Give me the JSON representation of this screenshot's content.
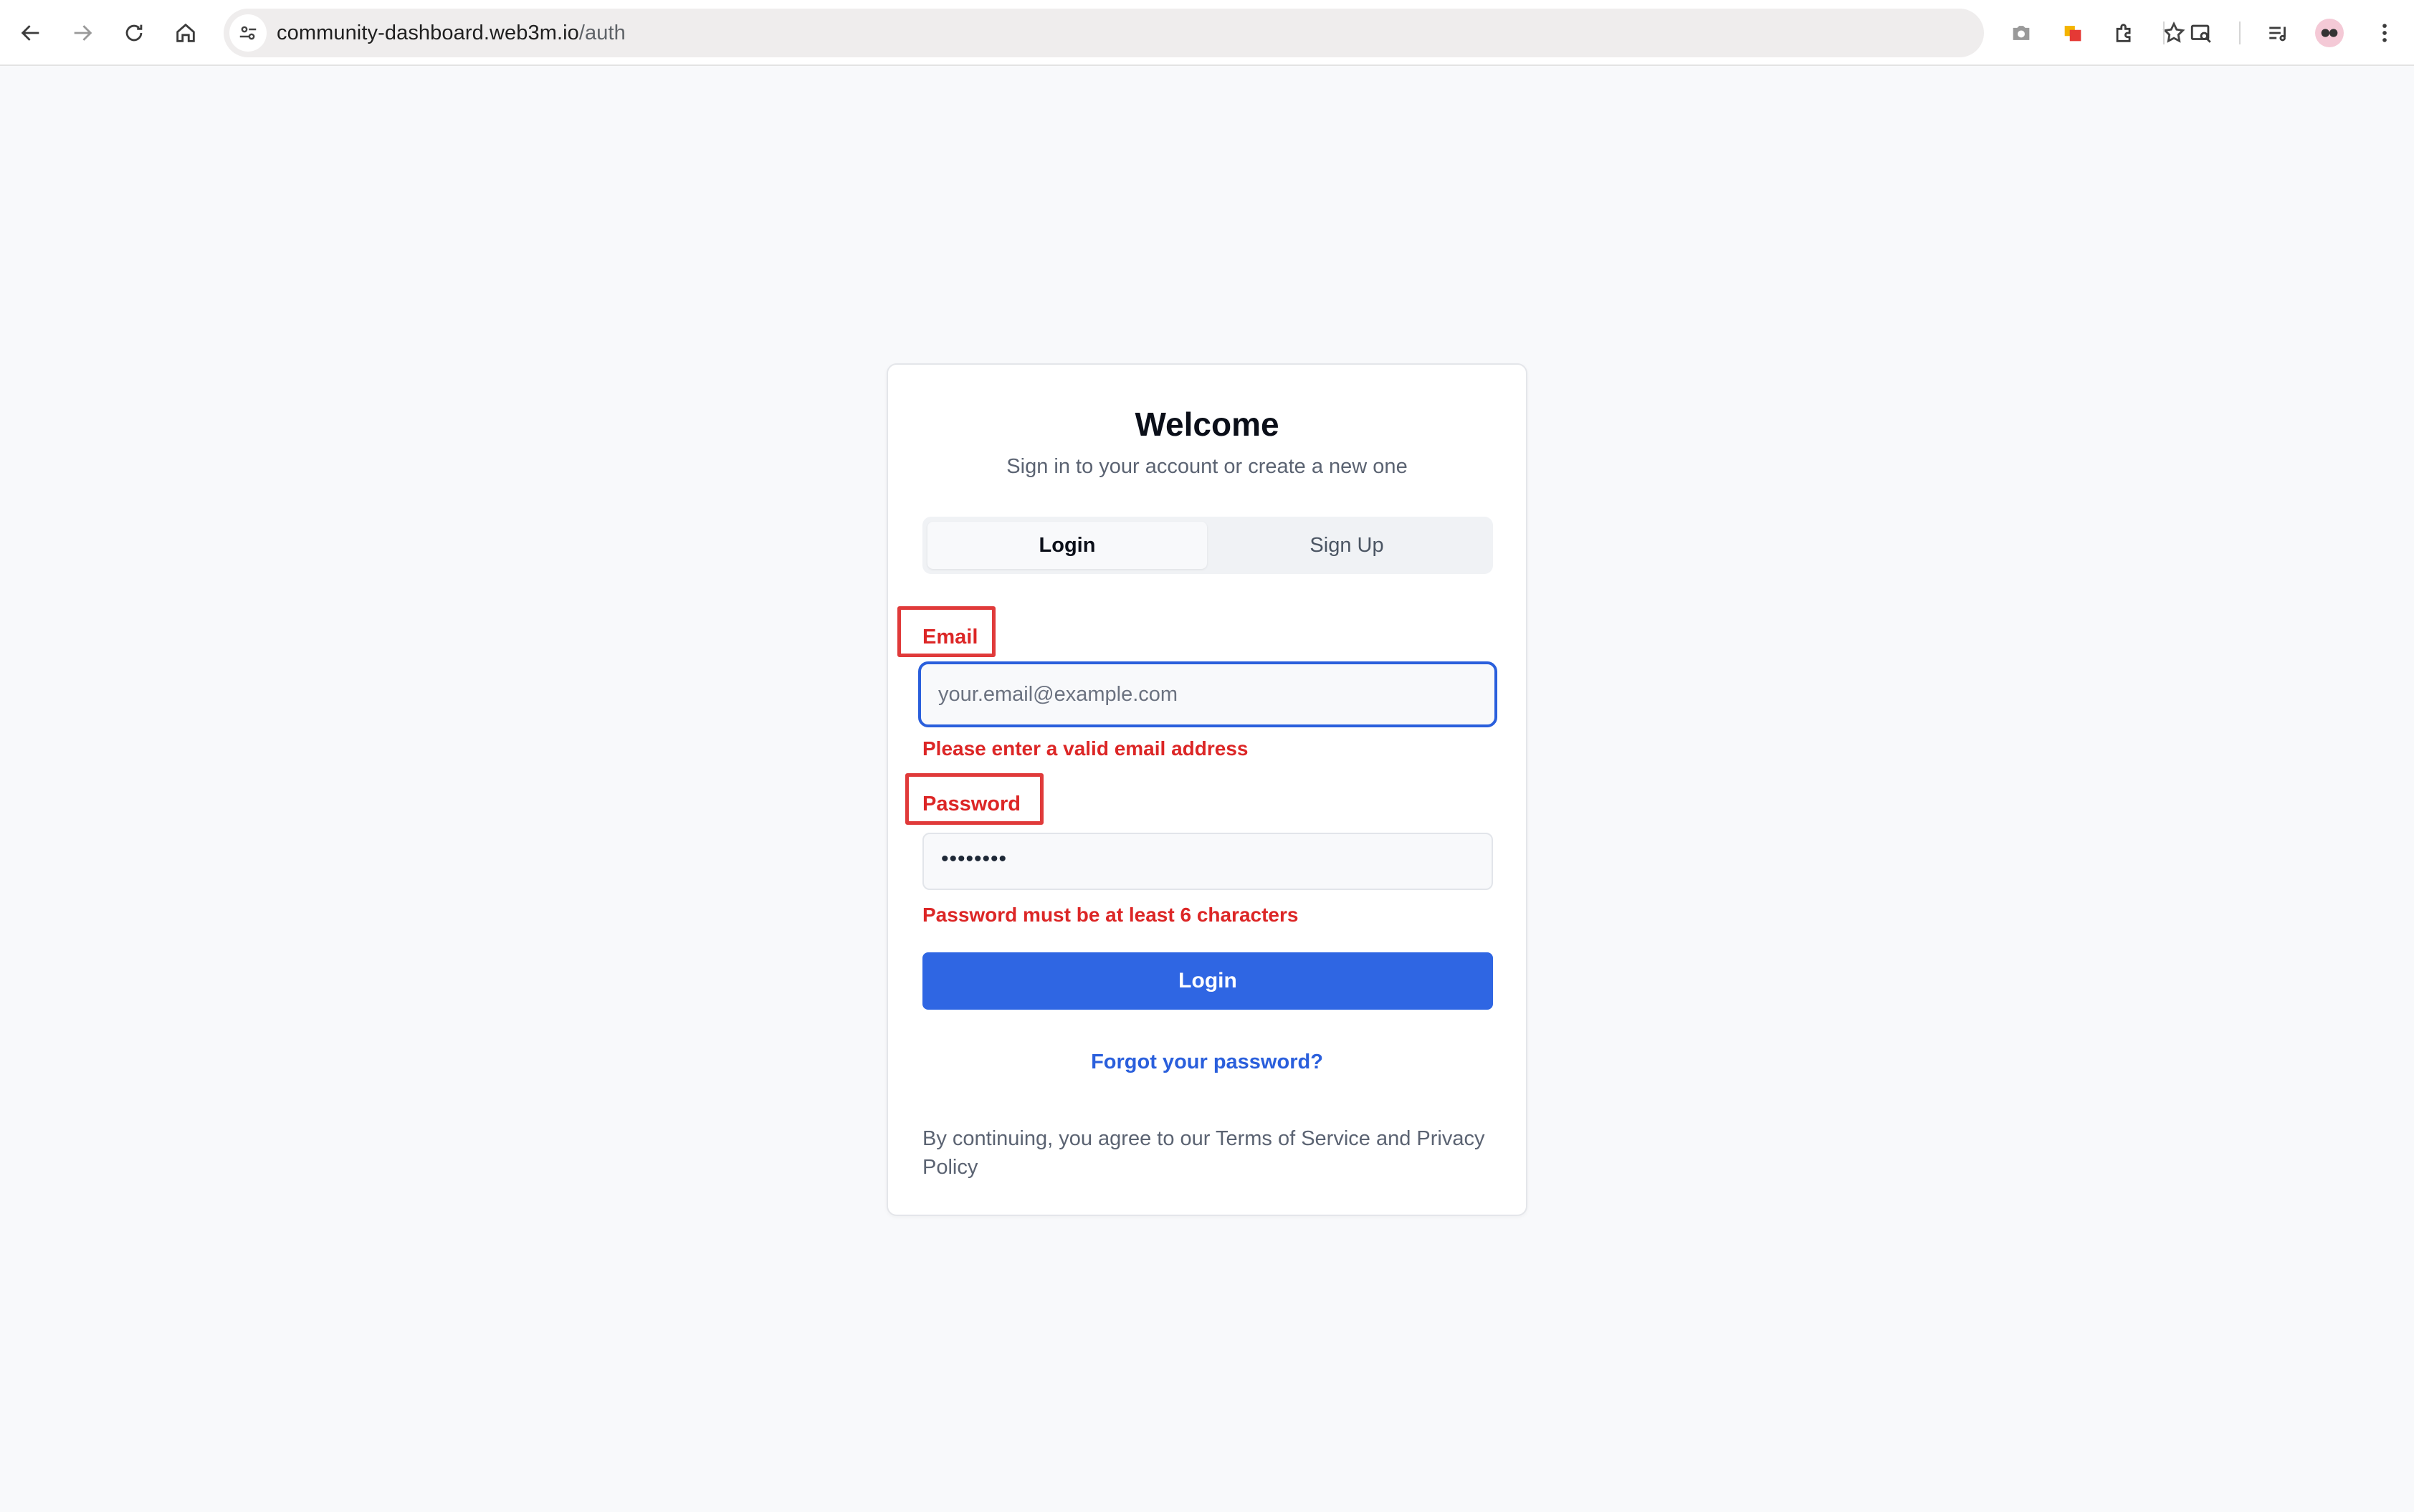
{
  "browser": {
    "url_host": "community-dashboard.web3m.io",
    "url_path": "/auth",
    "icons": [
      "back-icon",
      "forward-icon",
      "reload-icon",
      "home-icon",
      "site-info-icon",
      "bookmark-star-icon",
      "camera-icon",
      "extension-office-icon",
      "puzzle-icon",
      "search-tab-icon",
      "media-icon",
      "profile-avatar",
      "menu-icon"
    ]
  },
  "auth": {
    "title": "Welcome",
    "subtitle": "Sign in to your account or create a new one",
    "tabs": [
      {
        "label": "Login",
        "active": true
      },
      {
        "label": "Sign Up",
        "active": false
      }
    ],
    "email": {
      "label": "Email",
      "placeholder": "your.email@example.com",
      "value": "",
      "error": "Please enter a valid email address"
    },
    "password": {
      "label": "Password",
      "masked_value": "••••••••",
      "error": "Password must be at least 6 characters"
    },
    "submit_label": "Login",
    "forgot_label": "Forgot your password?",
    "terms_text": "By continuing, you agree to our Terms of Service and Privacy Policy"
  },
  "colors": {
    "accent": "#2f66e3",
    "error": "#dc2626",
    "highlight": "#e03a3a"
  }
}
